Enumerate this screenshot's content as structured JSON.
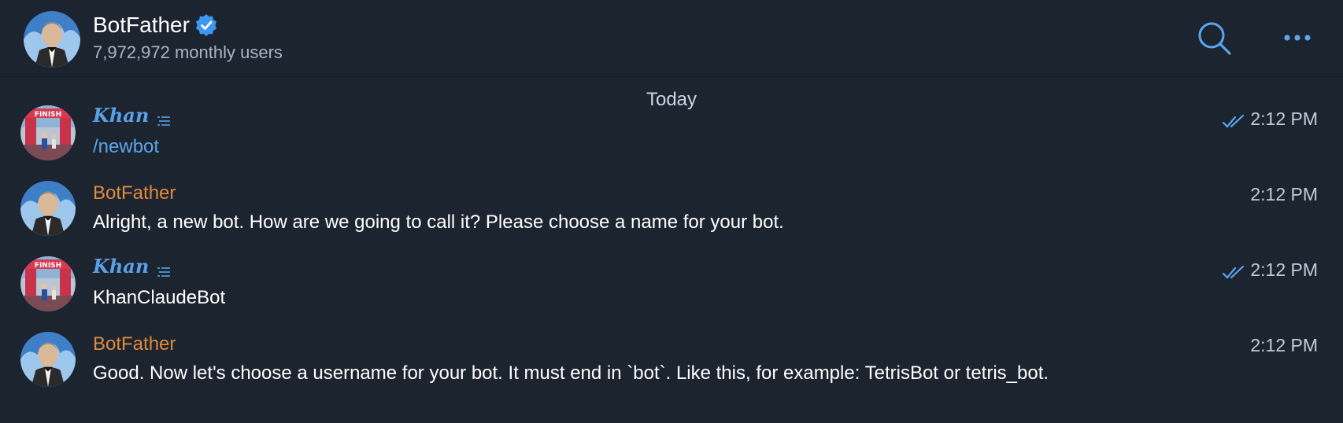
{
  "header": {
    "title": "BotFather",
    "subtitle": "7,972,972 monthly users"
  },
  "date_separator": "Today",
  "messages": [
    {
      "sender": "Khan",
      "text": "/newbot",
      "time": "2:12 PM",
      "read": true
    },
    {
      "sender": "BotFather",
      "text": "Alright, a new bot. How are we going to call it? Please choose a name for your bot.",
      "time": "2:12 PM",
      "read": false
    },
    {
      "sender": "Khan",
      "text": "KhanClaudeBot",
      "time": "2:12 PM",
      "read": true
    },
    {
      "sender": "BotFather",
      "text": "Good. Now let's choose a username for your bot. It must end in `bot`. Like this, for example: TetrisBot or tetris_bot.",
      "time": "2:12 PM",
      "read": false
    }
  ],
  "colors": {
    "background": "#1c2430",
    "accent": "#5aa6ee",
    "botfather_name": "#e08a3c",
    "khan_name": "#5aa0e8",
    "secondary_text": "#a9b5c3"
  },
  "icons": {
    "verified": "verified-badge-icon",
    "search": "search-icon",
    "more": "more-options-icon",
    "read": "double-check-icon",
    "list": "list-icon"
  }
}
